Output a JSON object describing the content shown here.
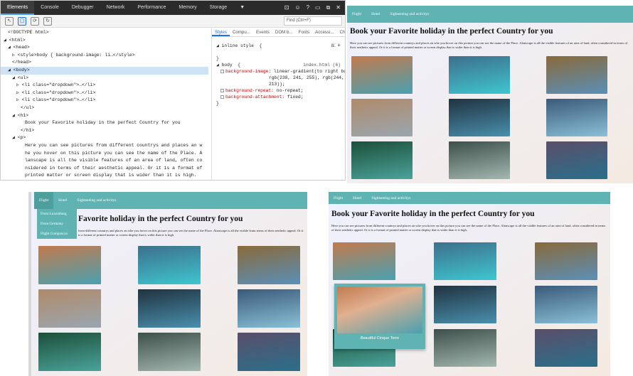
{
  "devtools": {
    "tabs": [
      "Elements",
      "Console",
      "Debugger",
      "Network",
      "Performance",
      "Memory",
      "Storage"
    ],
    "active_tab": "Elements",
    "find_placeholder": "Find (Ctrl+F)",
    "dom_lines": [
      {
        "t": "<!DOCTYPE html>",
        "ind": 2
      },
      {
        "t": "◢ <html>",
        "ind": 0
      },
      {
        "t": "◢ <head>",
        "ind": 2
      },
      {
        "t": "▷ <style>body { background-image: li…</style>",
        "ind": 4
      },
      {
        "t": "</head>",
        "ind": 4
      },
      {
        "t": "◢ <body>",
        "ind": 2,
        "hl": true
      },
      {
        "t": "◢ <ul>",
        "ind": 4
      },
      {
        "t": "▷ <li class=\"dropdown\">…</li>",
        "ind": 6
      },
      {
        "t": "▷ <li class=\"dropdown\">…</li>",
        "ind": 6
      },
      {
        "t": "▷ <li class=\"dropdown\">…</li>",
        "ind": 6
      },
      {
        "t": "</ul>",
        "ind": 8
      },
      {
        "t": "◢ <h1>",
        "ind": 4
      },
      {
        "t": "Book your Favorite holiday in the perfect Country for you",
        "ind": 10
      },
      {
        "t": "</h1>",
        "ind": 8
      },
      {
        "t": "◢ <p>",
        "ind": 4
      },
      {
        "t": "Here you can see pictures from different countrys and places an w",
        "ind": 10
      },
      {
        "t": "he you hover on this picture you can see the name of the Place. A",
        "ind": 10
      },
      {
        "t": "lanscape is all the visible features of an area of land, often co",
        "ind": 10
      },
      {
        "t": "nsidered in terms of their aesthetic appeal. Or it is a format of",
        "ind": 10
      },
      {
        "t": "printed matter or screen display that is wider than it is high.",
        "ind": 10
      },
      {
        "t": "</p>",
        "ind": 8
      },
      {
        "t": "▷ <table id=\"customers\">…</table>",
        "ind": 4
      }
    ],
    "styles_tabs": [
      "Styles",
      "Compu...",
      "Events",
      "DOM b...",
      "Fonts",
      "Accessi...",
      "Changes"
    ],
    "inline_style": "◢ inline style  {",
    "body_rule_selector": "◢ body  {",
    "body_rule_link": "index.html (6)",
    "decls": [
      {
        "p": "background-image:",
        "v": "linear-gradient(to right bottom,"
      },
      {
        "p": "",
        "v": "rgb(238, 241, 255), rgb(244, 234,"
      },
      {
        "p": "",
        "v": "213));"
      },
      {
        "p": "background-repeat:",
        "v": "no-repeat;"
      },
      {
        "p": "background-attachment:",
        "v": "fixed;"
      }
    ],
    "hov_label": "a:",
    "add_label": "+"
  },
  "site": {
    "nav": [
      "Flight",
      "Hotel",
      "Sightseeing and activitys"
    ],
    "title": "Book your Favorite holiday in the perfect Country for you",
    "title_cropped": "Favorite holiday in the perfect Country for you",
    "paragraph": "Here you can see pictures from different countrys and places an whe you hover on this picture you can see the name of the Place. Alanscape is all the visible features of an area of land, often considered in terms of their aesthetic appeal. Or it is a format of printed matter or screen display that is wider than it is high.",
    "paragraph_cropped": "from different countrys and places an whe you hover on this picture you can see the name of the Place. Alanscape is all the visible featu terms of their aesthetic appeal. Or it is a format of printed matter or screen display that is wider than it is high.",
    "dropdown": [
      "From Luxemburg",
      "From Germany",
      "Flight Compancys"
    ],
    "caption": "Beautiful Cinque Terre"
  },
  "photos": {
    "colors": [
      [
        "#c27a4d",
        "#4aa0b0"
      ],
      [
        "#3d6f8a",
        "#3ec6d0"
      ],
      [
        "#8a6a3a",
        "#5a8fb8"
      ],
      [
        "#b08a6a",
        "#9aa6b0"
      ],
      [
        "#20333f",
        "#4a8fae"
      ],
      [
        "#3a5a7a",
        "#8ac0d8"
      ],
      [
        "#1d4f3a",
        "#4aa39a"
      ],
      [
        "#3d4f4a",
        "#a3b8b0"
      ],
      [
        "#5a4e6a",
        "#2a6f8a"
      ]
    ]
  }
}
